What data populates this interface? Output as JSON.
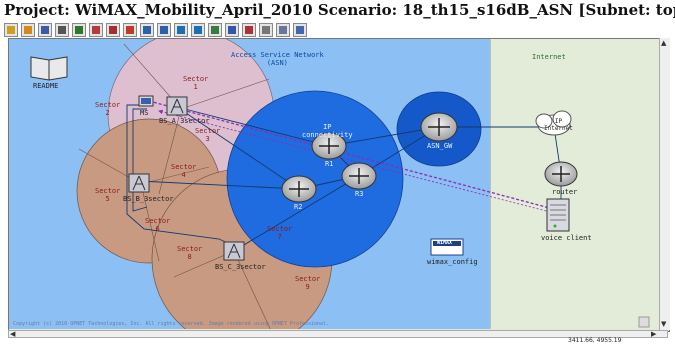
{
  "window": {
    "title": "Project: WiMAX_Mobility_April_2010 Scenario: 18_th15_s16dB_ASN  [Subnet: top"
  },
  "toolbar": {
    "buttons": [
      {
        "name": "new-icon",
        "color": "#c9a020"
      },
      {
        "name": "open-icon",
        "color": "#d38a1c"
      },
      {
        "name": "save-icon",
        "color": "#3d5aa8"
      },
      {
        "name": "print-icon",
        "color": "#555555"
      },
      {
        "name": "config-icon",
        "color": "#2a7a2a"
      },
      {
        "name": "palette-icon",
        "color": "#b23c3c"
      },
      {
        "name": "run-icon",
        "color": "#a32f2f"
      },
      {
        "name": "stop-icon",
        "color": "#c0392b"
      },
      {
        "name": "zoom-in-icon",
        "color": "#2e5fa8"
      },
      {
        "name": "zoom-out-icon",
        "color": "#2e5fa8"
      },
      {
        "name": "results-icon",
        "color": "#1d6fb5"
      },
      {
        "name": "statistics-icon",
        "color": "#1d6fb5"
      },
      {
        "name": "graph-icon",
        "color": "#3a7a3a"
      },
      {
        "name": "triangle-icon",
        "color": "#3355aa"
      },
      {
        "name": "wand-icon",
        "color": "#aa3333"
      },
      {
        "name": "table-icon",
        "color": "#777777"
      },
      {
        "name": "chart-icon",
        "color": "#667799"
      },
      {
        "name": "help-icon",
        "color": "#4466aa"
      }
    ]
  },
  "regions": {
    "asn": "Access Service Network\n(ASN)",
    "internet": "Internet"
  },
  "sectors": [
    {
      "name": "sector-1",
      "label": "Sector\n1"
    },
    {
      "name": "sector-2",
      "label": "Sector\n2"
    },
    {
      "name": "sector-3",
      "label": "Sector\n3"
    },
    {
      "name": "sector-4",
      "label": "Sector\n4"
    },
    {
      "name": "sector-5",
      "label": "Sector\n5"
    },
    {
      "name": "sector-6",
      "label": "Sector\n6"
    },
    {
      "name": "sector-7",
      "label": "Sector\n7"
    },
    {
      "name": "sector-8",
      "label": "Sector\n8"
    },
    {
      "name": "sector-9",
      "label": "Sector\n9"
    }
  ],
  "nodes": {
    "readme": "README",
    "mobile": "MS",
    "bs_a": "BS_A_3sector",
    "bs_b": "BS_B_3sector",
    "bs_c": "BS_C_3sector",
    "ip_connectivity": "IP\nconnectivity",
    "r1": "R1",
    "r2": "R2",
    "r3": "R3",
    "asn_gw": "ASN_GW",
    "ip_cloud": "IP\nInternet",
    "router": "router",
    "voice_client": "voice client",
    "wimax_logo": "WiMAX",
    "wimax_config": "wimax_config"
  },
  "copyright": "Copyright (c) 2010 OPNET Technologies, Inc. All rights reserved. Image rendered using OPNET Professional.",
  "status": {
    "coords": "3411.66, 4955.19"
  },
  "colors": {
    "asn_bg": "#8cbff4",
    "internet_bg": "#e2ecd8",
    "sector_pink": "#ddbfd0",
    "sector_brown": "#c89a82",
    "ip_blue": "#1f6be0",
    "asn_gw_blue": "#1558c9",
    "route_purple": "#8a2db3"
  }
}
